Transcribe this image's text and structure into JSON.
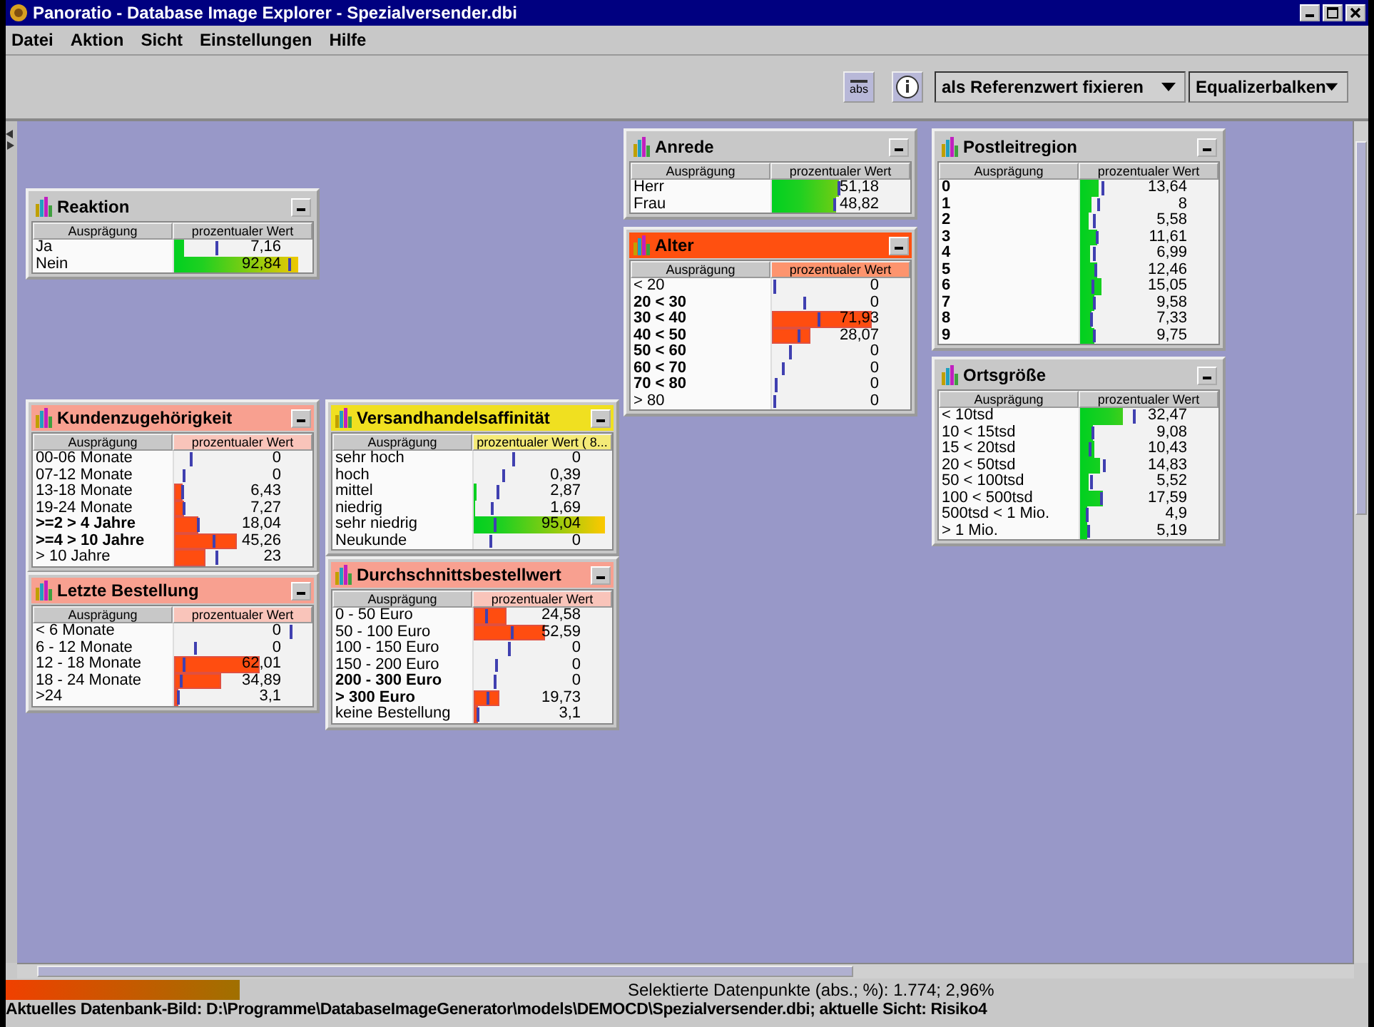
{
  "window": {
    "title": "Panoratio - Database Image Explorer - Spezialversender.dbi"
  },
  "menu": [
    "Datei",
    "Aktion",
    "Sicht",
    "Einstellungen",
    "Hilfe"
  ],
  "toolbar": {
    "buttons": [
      {
        "kind": "abs",
        "label": "abs"
      },
      {
        "kind": "info"
      }
    ],
    "dropdowns": [
      "als Referenzwert fixieren",
      "Equalizerbalken"
    ]
  },
  "panels": [
    {
      "title": "Reaktion",
      "color": "#c8c8c8",
      "kind": "gradient",
      "columns": [
        "Ausprägung",
        "prozentualer Wert"
      ],
      "rows": [
        {
          "label": "Ja",
          "bold": false,
          "value": "7,16",
          "level": 0.07
        },
        {
          "label": "Nein",
          "bold": false,
          "value": "92,84",
          "level": 0.9
        }
      ]
    },
    {
      "title": "Anrede",
      "color": "#c8c8c8",
      "kind": "gradient",
      "columns": [
        "Ausprägung",
        "prozentualer Wert"
      ],
      "rows": [
        {
          "label": "Herr",
          "bold": false,
          "value": "51,18",
          "level": 0.48
        },
        {
          "label": "Frau",
          "bold": false,
          "value": "48,82",
          "level": 0.46
        }
      ]
    },
    {
      "title": "Alter",
      "color": "#ff5010",
      "kind": "solid",
      "columns": [
        "Ausprägung",
        "prozentualer Wert"
      ],
      "rows": [
        {
          "label": "< 20",
          "bold": false,
          "value": "0"
        },
        {
          "label": "20 < 30",
          "bold": true,
          "value": "0"
        },
        {
          "label": "30 < 40",
          "bold": true,
          "value": "71,93",
          "level": 0.72
        },
        {
          "label": "40 < 50",
          "bold": true,
          "value": "28,07",
          "level": 0.28
        },
        {
          "label": "50 < 60",
          "bold": true,
          "value": "0"
        },
        {
          "label": "60 < 70",
          "bold": true,
          "value": "0"
        },
        {
          "label": "70 < 80",
          "bold": true,
          "value": "0"
        },
        {
          "label": "> 80",
          "bold": false,
          "value": "0"
        }
      ]
    },
    {
      "title": "Postleitregion",
      "color": "#c8c8c8",
      "kind": "gradient",
      "columns": [
        "Ausprägung",
        "prozentualer Wert"
      ],
      "rows": [
        {
          "label": "0",
          "bold": true,
          "value": "13,64",
          "level": 0.13
        },
        {
          "label": "1",
          "bold": true,
          "value": "8",
          "level": 0.08
        },
        {
          "label": "2",
          "bold": true,
          "value": "5,58",
          "level": 0.06
        },
        {
          "label": "3",
          "bold": true,
          "value": "11,61",
          "level": 0.12
        },
        {
          "label": "4",
          "bold": true,
          "value": "6,99",
          "level": 0.07
        },
        {
          "label": "5",
          "bold": true,
          "value": "12,46",
          "level": 0.12
        },
        {
          "label": "6",
          "bold": true,
          "value": "15,05",
          "level": 0.15
        },
        {
          "label": "7",
          "bold": true,
          "value": "9,58",
          "level": 0.1
        },
        {
          "label": "8",
          "bold": true,
          "value": "7,33",
          "level": 0.08
        },
        {
          "label": "9",
          "bold": true,
          "value": "9,75",
          "level": 0.1
        }
      ]
    },
    {
      "title": "Ortsgröße",
      "color": "#c8c8c8",
      "kind": "gradient",
      "columns": [
        "Ausprägung",
        "prozentualer Wert"
      ],
      "rows": [
        {
          "label": "< 10tsd",
          "bold": false,
          "value": "32,47",
          "level": 0.31
        },
        {
          "label": "10 < 15tsd",
          "bold": false,
          "value": "9,08",
          "level": 0.09
        },
        {
          "label": "15 < 20tsd",
          "bold": false,
          "value": "10,43",
          "level": 0.1
        },
        {
          "label": "20 < 50tsd",
          "bold": false,
          "value": "14,83",
          "level": 0.14
        },
        {
          "label": "50 < 100tsd",
          "bold": false,
          "value": "5,52",
          "level": 0.06
        },
        {
          "label": "100 < 500tsd",
          "bold": false,
          "value": "17,59",
          "level": 0.17
        },
        {
          "label": "500tsd < 1 Mio.",
          "bold": false,
          "value": "4,9",
          "level": 0.05
        },
        {
          "label": "> 1 Mio.",
          "bold": false,
          "value": "5,19",
          "level": 0.05
        }
      ]
    },
    {
      "title": "Kundenzugehörigkeit",
      "color": "#f8a090",
      "kind": "solid",
      "columns": [
        "Ausprägung",
        "prozentualer Wert"
      ],
      "rows": [
        {
          "label": "00-06 Monate",
          "bold": false,
          "value": "0"
        },
        {
          "label": "07-12 Monate",
          "bold": false,
          "value": "0"
        },
        {
          "label": "13-18 Monate",
          "bold": false,
          "value": "6,43",
          "level": 0.06
        },
        {
          "label": "19-24 Monate",
          "bold": false,
          "value": "7,27",
          "level": 0.07
        },
        {
          "label": ">=2 > 4 Jahre",
          "bold": true,
          "value": "18,04",
          "level": 0.18
        },
        {
          "label": ">=4 > 10 Jahre",
          "bold": true,
          "value": "45,26",
          "level": 0.45
        },
        {
          "label": "> 10 Jahre",
          "bold": false,
          "value": "23",
          "level": 0.23
        }
      ]
    },
    {
      "title": "Versandhandelsaffinität",
      "color": "#f0e020",
      "kind": "gradient",
      "columns": [
        "Ausprägung",
        "prozentualer Wert ( 8..."
      ],
      "rows": [
        {
          "label": "sehr hoch",
          "bold": false,
          "value": "0"
        },
        {
          "label": "hoch",
          "bold": false,
          "value": "0,39"
        },
        {
          "label": "mittel",
          "bold": false,
          "value": "2,87",
          "level": 0.02
        },
        {
          "label": "niedrig",
          "bold": false,
          "value": "1,69",
          "level": 0.01
        },
        {
          "label": "sehr niedrig",
          "bold": false,
          "value": "95,04",
          "level": 0.95
        },
        {
          "label": "Neukunde",
          "bold": false,
          "value": "0"
        }
      ]
    },
    {
      "title": "Letzte Bestellung",
      "color": "#f8a090",
      "kind": "solid",
      "columns": [
        "Ausprägung",
        "prozentualer Wert"
      ],
      "rows": [
        {
          "label": "< 6 Monate",
          "bold": false,
          "value": "0"
        },
        {
          "label": "6 - 12 Monate",
          "bold": false,
          "value": "0"
        },
        {
          "label": "12 - 18 Monate",
          "bold": false,
          "value": "62,01",
          "level": 0.62
        },
        {
          "label": "18 - 24 Monate",
          "bold": false,
          "value": "34,89",
          "level": 0.34
        },
        {
          "label": ">24",
          "bold": false,
          "value": "3,1",
          "level": 0.03
        }
      ]
    },
    {
      "title": "Durchschnittsbestellwert",
      "color": "#f8a090",
      "kind": "solid",
      "columns": [
        "Ausprägung",
        "prozentualer Wert"
      ],
      "rows": [
        {
          "label": "0 - 50 Euro",
          "bold": false,
          "value": "24,58",
          "level": 0.24
        },
        {
          "label": "50 - 100 Euro",
          "bold": false,
          "value": "52,59",
          "level": 0.52
        },
        {
          "label": "100 - 150 Euro",
          "bold": false,
          "value": "0"
        },
        {
          "label": "150 - 200 Euro",
          "bold": false,
          "value": "0"
        },
        {
          "label": "200 - 300 Euro",
          "bold": true,
          "value": "0"
        },
        {
          "label": "> 300 Euro",
          "bold": true,
          "value": "19,73",
          "level": 0.19
        },
        {
          "label": "keine Bestellung",
          "bold": false,
          "value": "3,1",
          "level": 0.03
        }
      ]
    }
  ],
  "status": {
    "selection": "Selektierte Datenpunkte (abs.; %): 1.774; 2,96%",
    "info": "Aktuelles Datenbank-Bild: D:\\Programme\\DatabaseImageGenerator\\models\\DEMOCD\\Spezialversender.dbi; aktuelle Sicht: Risiko4"
  }
}
